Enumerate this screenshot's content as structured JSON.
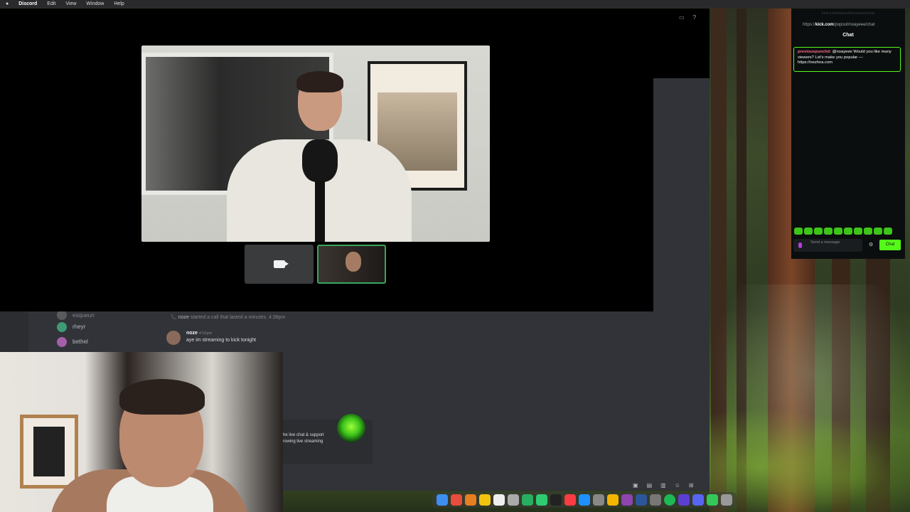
{
  "menubar": {
    "app": "Discord",
    "items": [
      "Edit",
      "View",
      "Window",
      "Help"
    ]
  },
  "discord": {
    "members": [
      {
        "name": "esqueun"
      },
      {
        "name": "rheyr"
      },
      {
        "name": "bethel"
      }
    ],
    "system_message": {
      "user": "noze",
      "text": "started a call that lasted a minutes.",
      "time": "4:38pm"
    },
    "message": {
      "user": "noze",
      "time": "4:52pm",
      "text": "aye im streaming to kick tonight"
    },
    "embed": {
      "line1": "he live chat & support",
      "line2": "rowing live streaming"
    }
  },
  "kick_chat": {
    "window_title": "kick.com/popout/noayeee/chat",
    "url_prefix": "https://",
    "url_domain": "kick.com",
    "url_path": "/popout/noayeee/chat",
    "header": "Chat",
    "message": {
      "user": "previouspunchd:",
      "text": "@noayeee Would you like many viewers? Let's make you popular — https://nezhna.com"
    },
    "input_placeholder": "Send a message",
    "chat_button": "Chat",
    "accent": "#53fc18"
  },
  "icons": [
    "camera-icon",
    "gear-icon",
    "emoji-icon",
    "mic-icon"
  ]
}
